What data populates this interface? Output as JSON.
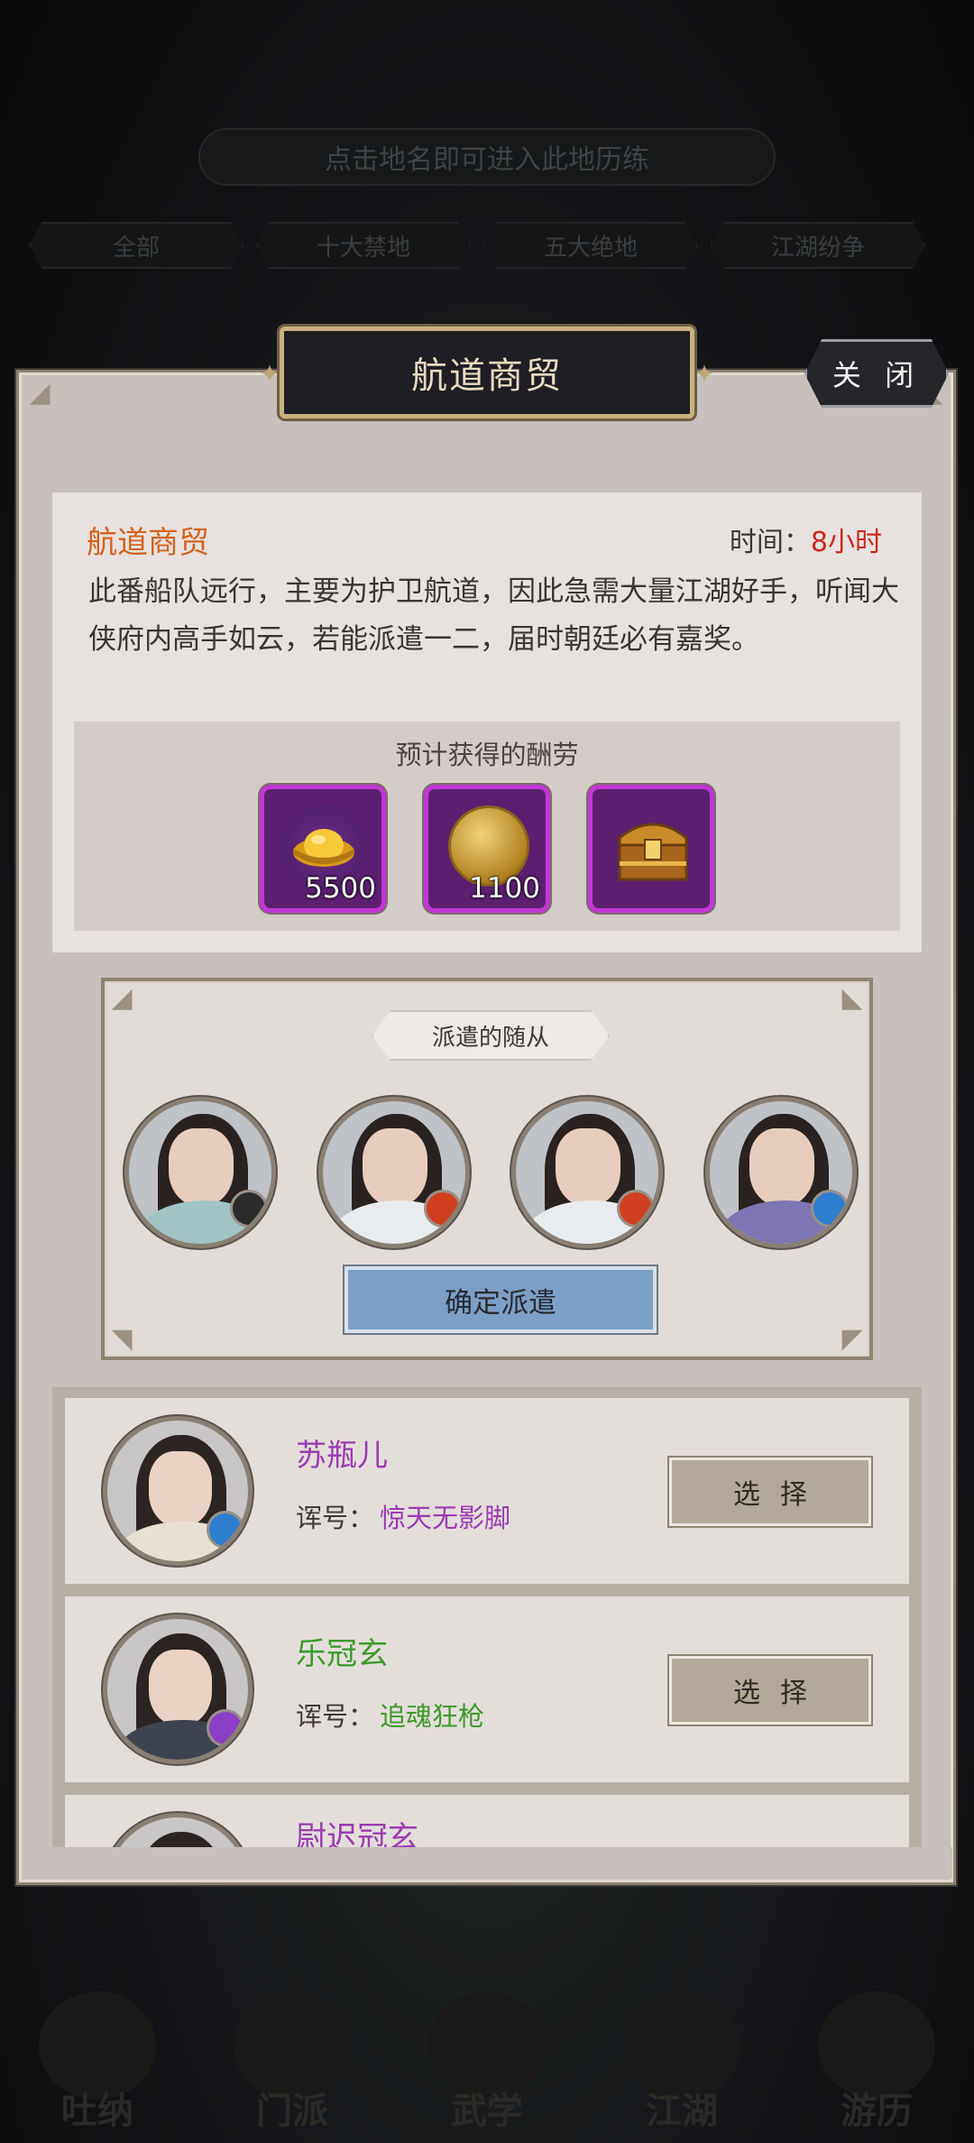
{
  "background": {
    "hint": "点击地名即可进入此地历练",
    "tabs": [
      "全部",
      "十大禁地",
      "五大绝地",
      "江湖纷争"
    ],
    "bottom_nav": [
      "吐纳",
      "门派",
      "武学",
      "江湖",
      "游历"
    ]
  },
  "dialog": {
    "title": "航道商贸",
    "close_label": "关 闭",
    "mission": {
      "name": "航道商贸",
      "time_label": "时间：",
      "time_value": "8小时",
      "description": "此番船队远行，主要为护卫航道，因此急需大量江湖好手，听闻大侠府内高手如云，若能派遣一二，届时朝廷必有嘉奖。"
    },
    "rewards": {
      "title": "预计获得的酬劳",
      "items": [
        {
          "icon": "gold-ingot-icon",
          "count": "5500"
        },
        {
          "icon": "gold-medal-icon",
          "count": "1100"
        },
        {
          "icon": "treasure-chest-icon",
          "count": ""
        }
      ]
    },
    "dispatch": {
      "label": "派遣的随从",
      "confirm_label": "确定派遣",
      "slots": [
        {
          "name": "female-follower",
          "badge_icon": "fist-class-icon",
          "badge_color": "#2b2b2b"
        },
        {
          "name": "male-follower",
          "badge_icon": "blade-class-icon",
          "badge_color": "#d1401e"
        },
        {
          "name": "male-follower",
          "badge_icon": "blade-class-icon",
          "badge_color": "#d1401e"
        },
        {
          "name": "male-follower",
          "badge_icon": "sword-class-icon",
          "badge_color": "#2f7fd0"
        }
      ]
    },
    "followers": [
      {
        "name": "苏瓶儿",
        "name_color": "#9a3bb0",
        "title_label": "诨号：",
        "title": "惊天无影脚",
        "title_color": "#9a3bb0",
        "select_label": "选择",
        "badge_color": "#2f7fd0"
      },
      {
        "name": "乐冠玄",
        "name_color": "#3d9a2a",
        "title_label": "诨号：",
        "title": "追魂狂枪",
        "title_color": "#3d9a2a",
        "select_label": "选择",
        "badge_color": "#8b3fc6"
      },
      {
        "name": "尉迟冠玄",
        "name_color": "#9a3bb0",
        "title_label": "",
        "title": "",
        "title_color": "#9a3bb0",
        "select_label": "",
        "badge_color": "#2f7fd0"
      }
    ]
  },
  "colors": {
    "accent_orange": "#d4621b",
    "time_red": "#c9281f",
    "reward_purple": "#c236d6",
    "confirm_blue": "#7c9fc7"
  }
}
